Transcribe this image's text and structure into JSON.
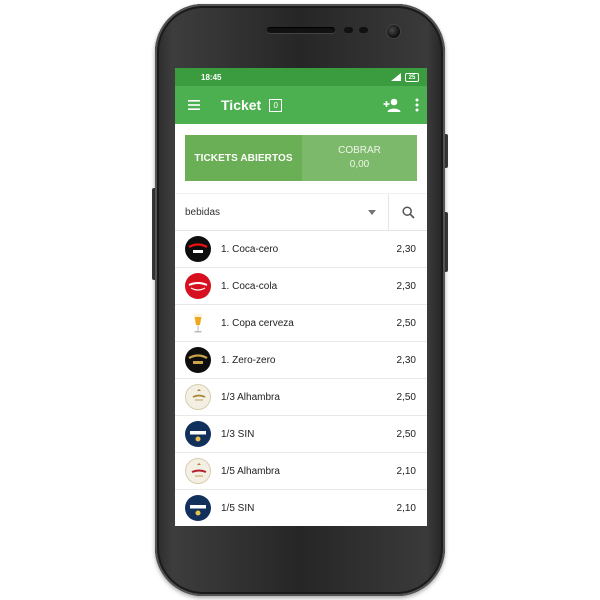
{
  "statusbar": {
    "time": "18:45",
    "battery": "25"
  },
  "appbar": {
    "title": "Ticket",
    "count": "0"
  },
  "actions": {
    "open_tickets": "TICKETS ABIERTOS",
    "charge_label": "COBRAR",
    "charge_amount": "0,00"
  },
  "filter": {
    "category": "bebidas"
  },
  "products": [
    {
      "name": "1. Coca-cero",
      "price": "2,30",
      "icon": "coca-cola-zero-logo"
    },
    {
      "name": "1. Coca-cola",
      "price": "2,30",
      "icon": "coca-cola-logo"
    },
    {
      "name": "1. Copa cerveza",
      "price": "2,50",
      "icon": "beer-glass"
    },
    {
      "name": "1. Zero-zero",
      "price": "2,30",
      "icon": "coca-cola-zero-logo"
    },
    {
      "name": "1/3 Alhambra",
      "price": "2,50",
      "icon": "alhambra-logo"
    },
    {
      "name": "1/3 SIN",
      "price": "2,50",
      "icon": "buckler-logo"
    },
    {
      "name": "1/5 Alhambra",
      "price": "2,10",
      "icon": "alhambra-logo"
    },
    {
      "name": "1/5 SIN",
      "price": "2,10",
      "icon": "buckler-logo"
    }
  ]
}
